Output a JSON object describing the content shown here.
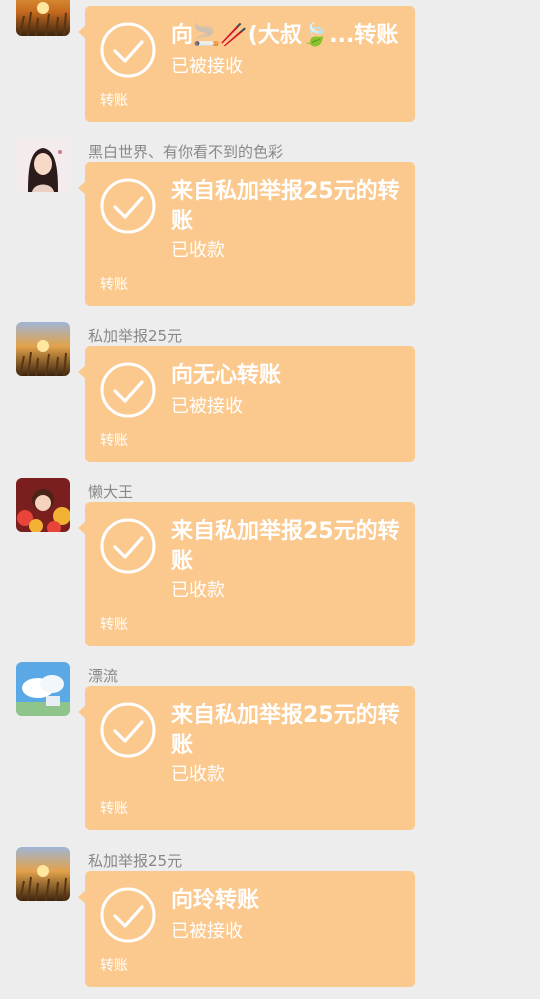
{
  "messages": [
    {
      "sender": "",
      "avatar": "wheat-field-sunset-avatar",
      "title": "向🚬🥢(大叔🍃...转账",
      "status": "已被接收",
      "footer": "转账"
    },
    {
      "sender": "黑白世界、有你看不到的色彩",
      "avatar": "illustrated-girl-avatar",
      "title": "来自私加举报25元的转账",
      "status": "已收款",
      "footer": "转账"
    },
    {
      "sender": "私加举报25元",
      "avatar": "wheat-field-sunset-avatar",
      "title": "向无心转账",
      "status": "已被接收",
      "footer": "转账"
    },
    {
      "sender": "懒大王",
      "avatar": "cartoon-child-red-flowers-avatar",
      "title": "来自私加举报25元的转账",
      "status": "已收款",
      "footer": "转账"
    },
    {
      "sender": "漂流",
      "avatar": "anime-sky-clouds-avatar",
      "title": "来自私加举报25元的转账",
      "status": "已收款",
      "footer": "转账"
    },
    {
      "sender": "私加举报25元",
      "avatar": "wheat-field-sunset-avatar",
      "title": "向玲转账",
      "status": "已被接收",
      "footer": "转账"
    }
  ],
  "colors": {
    "background": "#ededed",
    "transfer_card": "#fbc98e",
    "text_on_card": "#ffffff",
    "sender_text": "#888888"
  }
}
